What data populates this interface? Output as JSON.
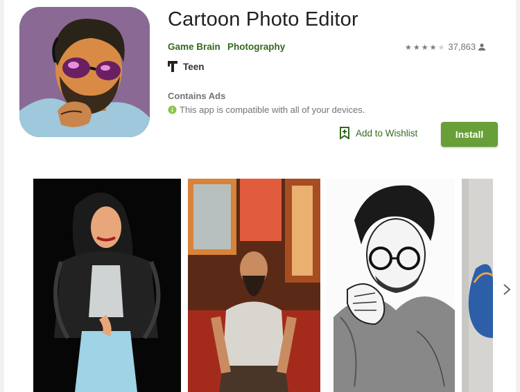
{
  "app": {
    "title": "Cartoon Photo Editor",
    "developer": "Game Brain",
    "category": "Photography",
    "rating_count": "37,863",
    "rating_stars": 4,
    "content_rating": "Teen",
    "contains_ads": "Contains Ads",
    "compatibility": "This app is compatible with all of your devices.",
    "wishlist_label": "Add to Wishlist",
    "install_label": "Install"
  },
  "colors": {
    "accent": "#33691e",
    "install_bg": "#689f38"
  },
  "icons": [
    "person-icon",
    "teen-rating-icon",
    "info-icon",
    "bookmark-add-icon",
    "chevron-right-icon"
  ],
  "screenshots": [
    {
      "name": "screenshot-woman-leather-jacket"
    },
    {
      "name": "screenshot-bearded-man-sitting"
    },
    {
      "name": "screenshot-man-glasses-sketch"
    },
    {
      "name": "screenshot-partial-cartoon"
    }
  ]
}
